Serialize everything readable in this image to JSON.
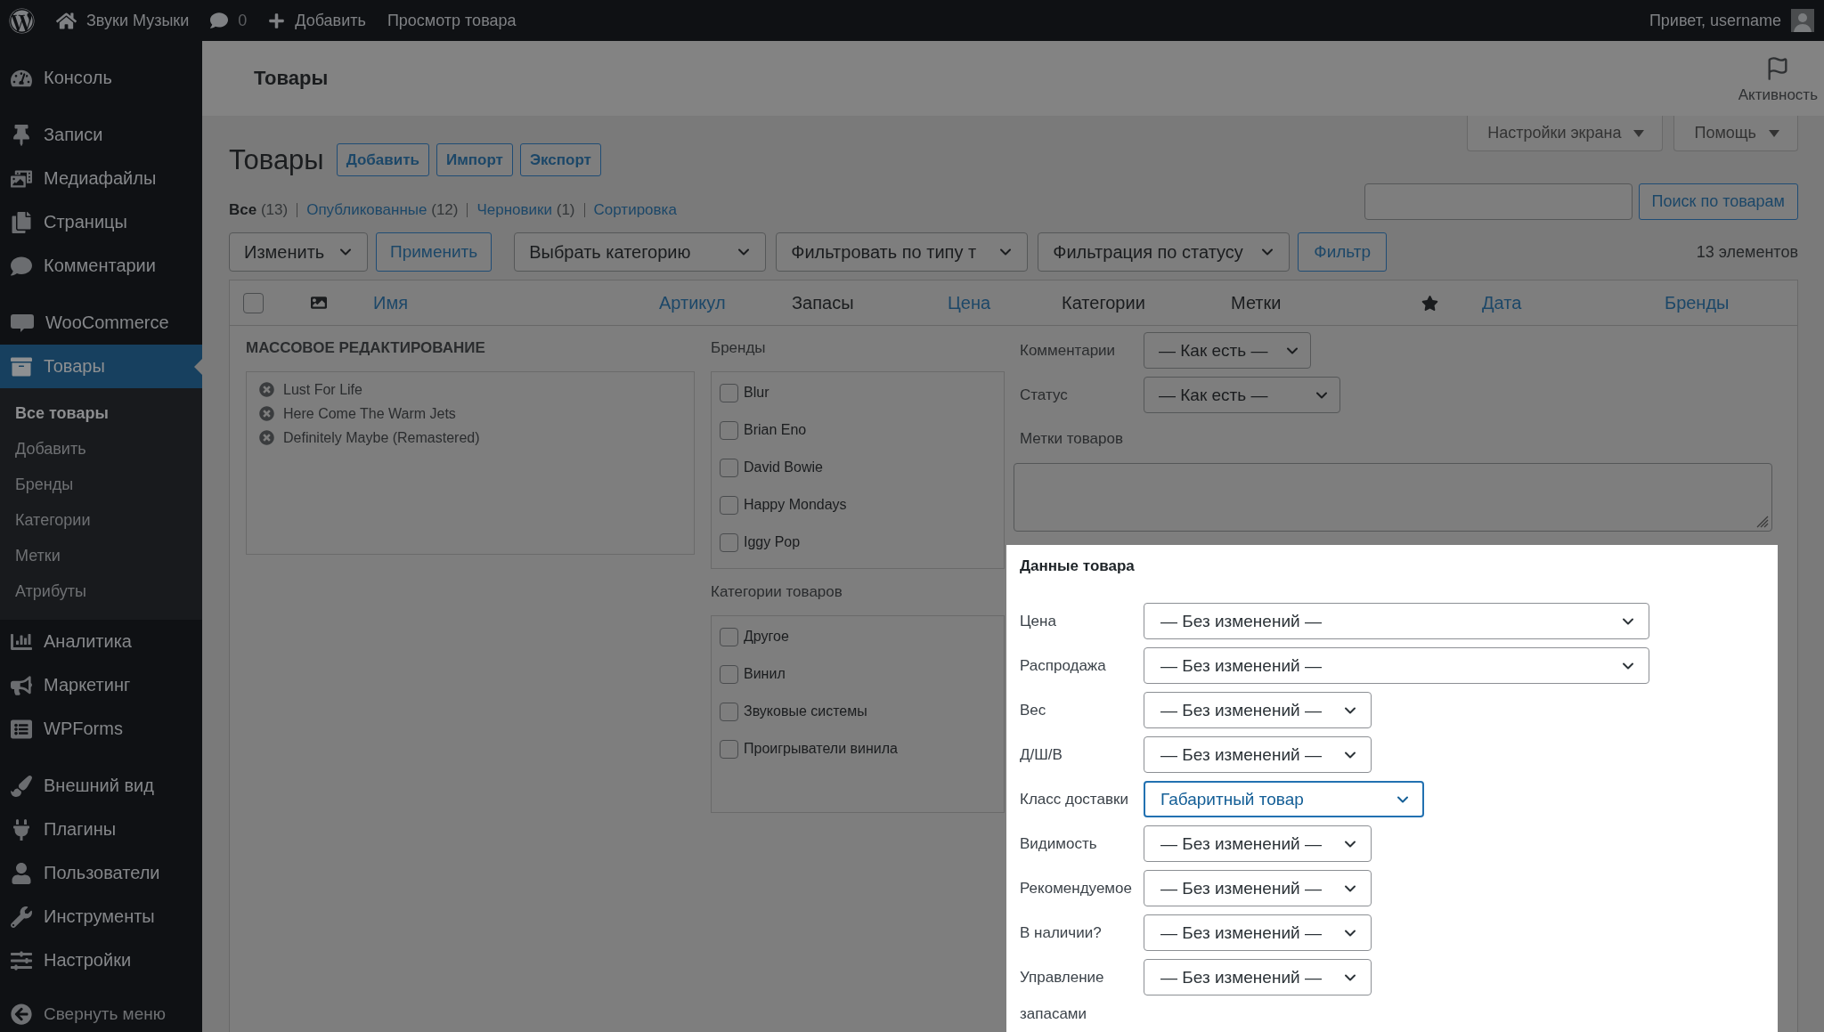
{
  "admin_bar": {
    "site_name": "Звуки Музыки",
    "comments": "0",
    "new": "Добавить",
    "view": "Просмотр товара",
    "greeting": "Привет, username"
  },
  "sidebar": {
    "sections": [
      {
        "items": [
          {
            "label": "Консоль",
            "selected": false
          }
        ]
      },
      {
        "items": [
          {
            "label": "Записи",
            "selected": false
          },
          {
            "label": "Медиафайлы",
            "selected": false
          },
          {
            "label": "Страницы",
            "selected": false
          },
          {
            "label": "Комментарии",
            "selected": false
          }
        ]
      },
      {
        "items": [
          {
            "label": "WooCommerce",
            "selected": false
          },
          {
            "label": "Товары",
            "selected": true,
            "children": [
              {
                "label": "Все товары",
                "selected": true
              },
              {
                "label": "Добавить",
                "selected": false
              },
              {
                "label": "Бренды",
                "selected": false
              },
              {
                "label": "Категории",
                "selected": false
              },
              {
                "label": "Метки",
                "selected": false
              },
              {
                "label": "Атрибуты",
                "selected": false
              }
            ]
          },
          {
            "label": "Аналитика",
            "selected": false
          },
          {
            "label": "Маркетинг",
            "selected": false
          },
          {
            "label": "WPForms",
            "selected": false
          }
        ]
      },
      {
        "items": [
          {
            "label": "Внешний вид",
            "selected": false
          },
          {
            "label": "Плагины",
            "selected": false
          },
          {
            "label": "Пользователи",
            "selected": false
          },
          {
            "label": "Инструменты",
            "selected": false
          },
          {
            "label": "Настройки",
            "selected": false
          }
        ]
      }
    ],
    "collapse": "Свернуть меню"
  },
  "header": {
    "title": "Товары",
    "activity": "Активность"
  },
  "screen_tabs": [
    "Настройки экрана",
    "Помощь"
  ],
  "page": {
    "title": "Товары",
    "actions": [
      "Добавить",
      "Импорт",
      "Экспорт"
    ]
  },
  "views": [
    {
      "label": "Все",
      "count": "(13)",
      "selected": true
    },
    {
      "label": "Опубликованные",
      "count": "(12)",
      "selected": false
    },
    {
      "label": "Черновики",
      "count": "(1)",
      "selected": false
    },
    {
      "label": "Сортировка",
      "selected": false
    }
  ],
  "search": {
    "button": "Поиск по товарам"
  },
  "toolbar": {
    "bulk_action": "Изменить",
    "apply": "Применить",
    "filters": [
      "Выбрать категорию",
      "Фильтровать по типу т",
      "Фильтрация по статусу"
    ],
    "filter_button": "Фильтр",
    "count": "13 элементов"
  },
  "table": {
    "select_all": {
      "checked": false
    },
    "columns": [
      {
        "kind": "image"
      },
      {
        "kind": "link",
        "label": "Имя"
      },
      {
        "kind": "link",
        "label": "Артикул"
      },
      {
        "kind": "text",
        "label": "Запасы"
      },
      {
        "kind": "link",
        "label": "Цена"
      },
      {
        "kind": "text",
        "label": "Категории"
      },
      {
        "kind": "text",
        "label": "Метки"
      },
      {
        "kind": "star"
      },
      {
        "kind": "link",
        "label": "Дата"
      },
      {
        "kind": "link",
        "label": "Бренды"
      }
    ]
  },
  "bulk_edit": {
    "title": "МАССОВОЕ РЕДАКТИРОВАНИЕ",
    "products": [
      "Lust For Life",
      "Here Come The Warm Jets",
      "Definitely Maybe (Remastered)"
    ],
    "brands": {
      "label": "Бренды",
      "items": [
        {
          "label": "Blur",
          "checked": false
        },
        {
          "label": "Brian Eno",
          "checked": false
        },
        {
          "label": "David Bowie",
          "checked": false
        },
        {
          "label": "Happy Mondays",
          "checked": false
        },
        {
          "label": "Iggy Pop",
          "checked": false
        }
      ]
    },
    "categories": {
      "label": "Категории товаров",
      "items": [
        {
          "label": "Другое",
          "checked": false
        },
        {
          "label": "Винил",
          "checked": false
        },
        {
          "label": "Звуковые системы",
          "checked": false
        },
        {
          "label": "Проигрыватели винила",
          "checked": false
        }
      ]
    },
    "fields": [
      {
        "label": "Комментарии",
        "value": "— Как есть —",
        "kind": "compact"
      },
      {
        "label": "Статус",
        "value": "— Как есть —",
        "kind": "wide"
      }
    ],
    "tags": {
      "label": "Метки товаров"
    }
  },
  "product_data": {
    "title": "Данные товара",
    "fields": [
      {
        "label": "Цена",
        "value": "— Без изменений —",
        "kind": "wide",
        "focused": false
      },
      {
        "label": "Распродажа",
        "value": "— Без изменений —",
        "kind": "wide",
        "focused": false
      },
      {
        "label": "Вес",
        "value": "— Без изменений —",
        "kind": "compact",
        "focused": false
      },
      {
        "label": "Д/Ш/В",
        "value": "— Без изменений —",
        "kind": "compact",
        "focused": false
      },
      {
        "label": "Класс доставки",
        "value": "Габаритный товар",
        "kind": "medium",
        "focused": true
      },
      {
        "label": "Видимость",
        "value": "— Без изменений —",
        "kind": "compact",
        "focused": false
      },
      {
        "label": "Рекомендуемое",
        "value": "— Без изменений —",
        "kind": "compact",
        "focused": false
      },
      {
        "label": "В наличии?",
        "value": "— Без изменений —",
        "kind": "compact",
        "focused": false
      },
      {
        "label": "Управление запасами",
        "value": "— Без изменений —",
        "kind": "compact",
        "focused": false
      }
    ]
  }
}
